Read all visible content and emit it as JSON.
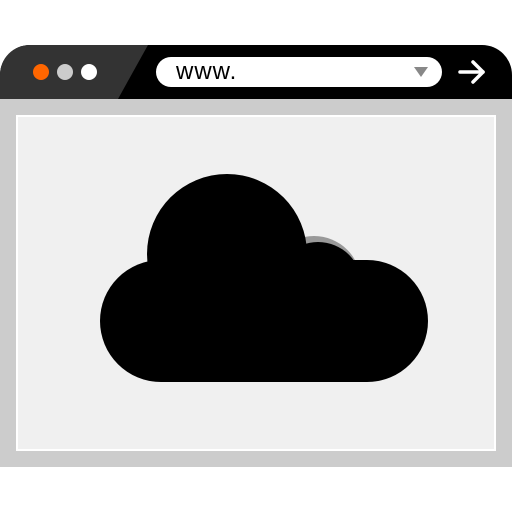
{
  "address_bar": {
    "url": "www."
  },
  "window_controls": {
    "close_color": "#ff6600",
    "minimize_color": "#cccccc",
    "maximize_color": "#ffffff"
  },
  "icons": {
    "go": "arrow-right-icon",
    "dropdown": "dropdown-triangle-icon",
    "content": "cloud-icon"
  },
  "colors": {
    "title_bar": "#000000",
    "title_bar_accent": "#333333",
    "frame": "#cccccc",
    "content_bg": "#f0f0f0",
    "cloud": "#000000",
    "cloud_highlight": "#999999"
  }
}
